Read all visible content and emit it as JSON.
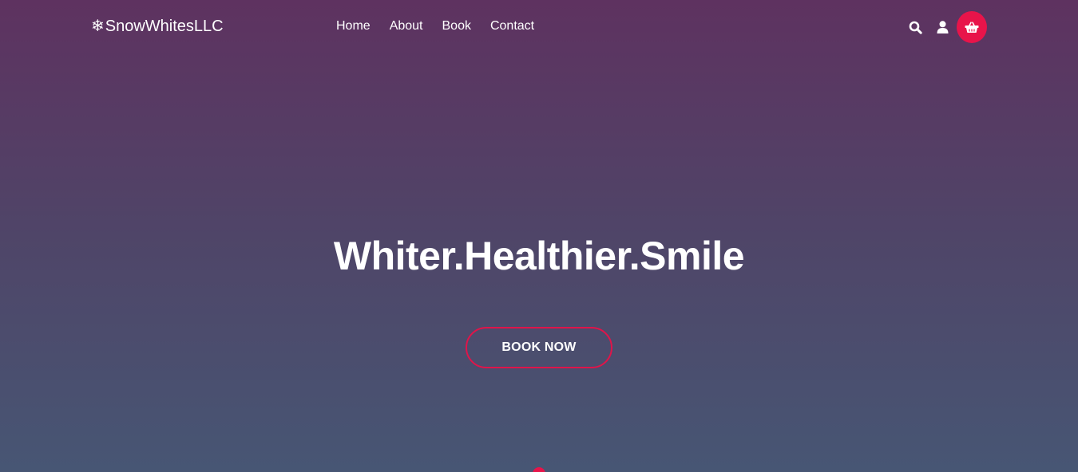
{
  "brand": {
    "icon": "❄",
    "name": "SnowWhitesLLC"
  },
  "nav": {
    "links": [
      {
        "label": "Home"
      },
      {
        "label": "About"
      },
      {
        "label": "Book"
      },
      {
        "label": "Contact"
      }
    ],
    "icons": {
      "search": "search-icon",
      "user": "user-icon",
      "cart": "shopping-basket-icon"
    }
  },
  "hero": {
    "title": "Whiter.Healthier.Smile",
    "cta_label": "BOOK NOW"
  },
  "colors": {
    "accent": "#e8144a",
    "gradient_top": "#5e3260",
    "gradient_bottom": "#475674",
    "text": "#ffffff"
  }
}
